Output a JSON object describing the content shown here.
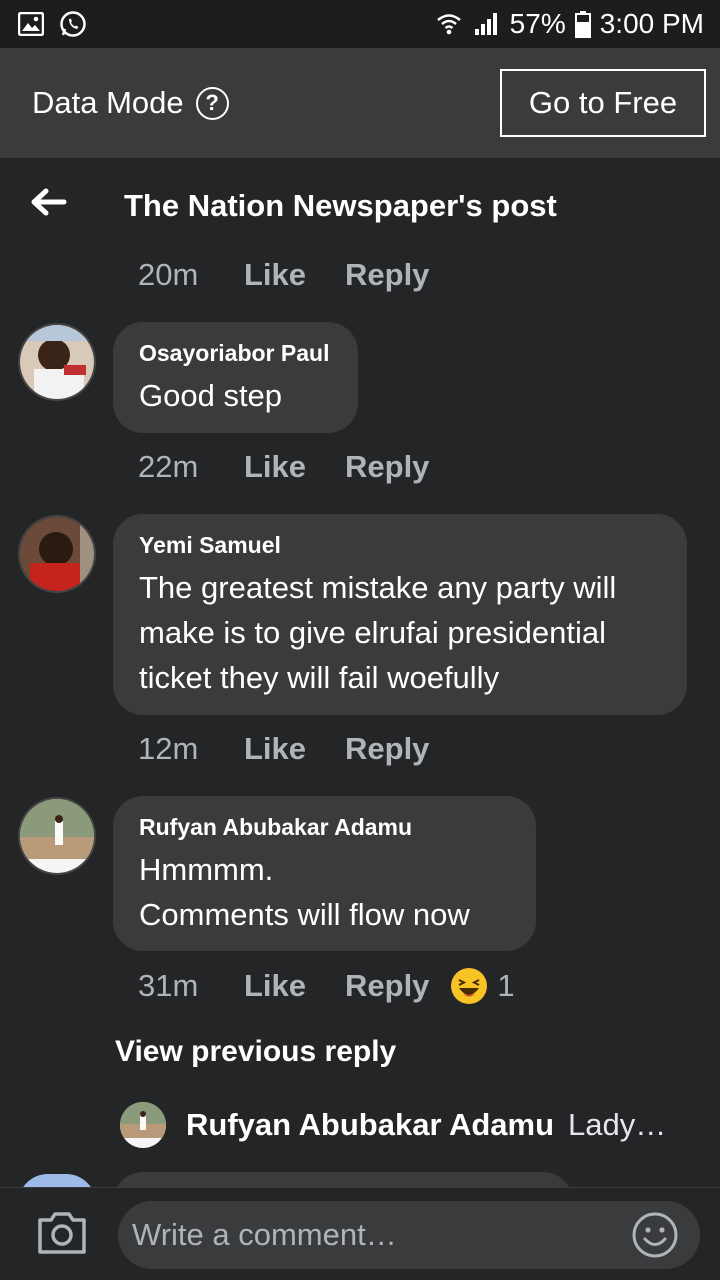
{
  "status_bar": {
    "battery": "57%",
    "time": "3:00 PM"
  },
  "data_mode": {
    "label": "Data Mode",
    "help_symbol": "?",
    "go_free_label": "Go to Free"
  },
  "header": {
    "title": "The Nation Newspaper's post"
  },
  "top_actions": {
    "time": "20m",
    "like": "Like",
    "reply": "Reply"
  },
  "comments": [
    {
      "name": "Osayoriabor Paul",
      "text": "Good step",
      "time": "22m",
      "like": "Like",
      "reply": "Reply"
    },
    {
      "name": "Yemi Samuel",
      "text_lines": [
        "The greatest mistake any party will",
        "make is to give elrufai presidential",
        "ticket they will fail woefully"
      ],
      "time": "12m",
      "like": "Like",
      "reply": "Reply"
    },
    {
      "name": "Rufyan Abubakar Adamu",
      "text_lines": [
        "Hmmmm.",
        "Comments will flow now"
      ],
      "time": "31m",
      "like": "Like",
      "reply": "Reply",
      "reaction_count": "1"
    }
  ],
  "view_previous": "View previous reply",
  "sub_reply": {
    "name": "Rufyan Abubakar Adamu",
    "text": "Lady…"
  },
  "composer": {
    "placeholder": "Write a comment…"
  },
  "colors": {
    "background": "#242526",
    "bubble": "#3a3b3c",
    "muted": "#b0b3b8",
    "status_bar": "#1c1d1e"
  }
}
